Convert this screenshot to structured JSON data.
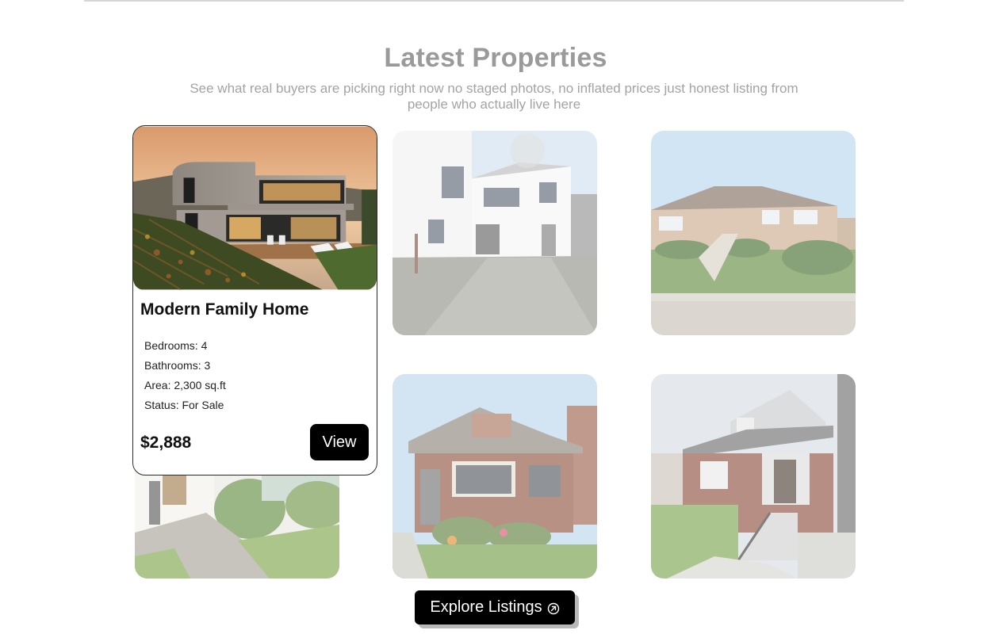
{
  "section": {
    "title": "Latest Properties",
    "subtitle": "See what real buyers are picking right now no staged photos, no inflated prices just honest listing from people who actually live here"
  },
  "featured": {
    "title": "Modern Family Home",
    "details": [
      "Bedrooms: 4",
      "Bathrooms: 3",
      "Area: 2,300 sq.ft",
      "Status: For Sale"
    ],
    "price": "$2,888",
    "button_label": "View"
  },
  "cta": {
    "label": "Explore Listings",
    "icon": "arrow-up-right-circle-icon"
  },
  "colors": {
    "title": "#9a9a9a",
    "subtitle": "#a3a3a3",
    "button_bg": "#000000",
    "button_text": "#ffffff"
  }
}
